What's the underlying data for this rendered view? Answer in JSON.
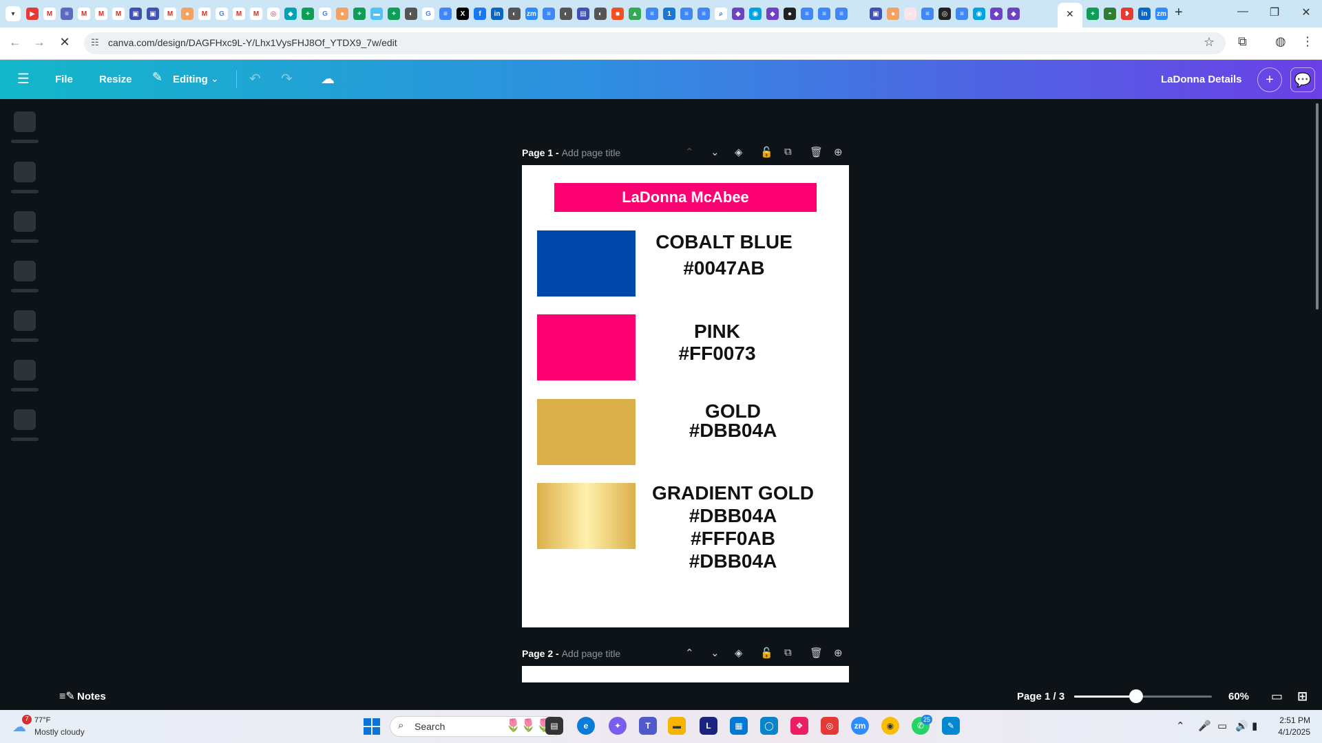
{
  "browser": {
    "url": "canva.com/design/DAGFHxc9L-Y/Lhx1VysFHJ8Of_YTDX9_7w/edit",
    "new_tab": "+",
    "win_min": "—",
    "win_max": "❐",
    "win_close": "✕",
    "tab_close": "✕"
  },
  "canva": {
    "file_label": "File",
    "resize_label": "Resize",
    "editing_label": "Editing",
    "doc_title": "LaDonna Details",
    "colors": {
      "brand_gradient_start": "#12b7c9",
      "brand_gradient_end": "#6b3fe6"
    }
  },
  "pages": [
    {
      "prefix": "Page 1 -",
      "title_placeholder": "Add page title"
    },
    {
      "prefix": "Page 2 -",
      "title_placeholder": "Add page title"
    }
  ],
  "design": {
    "name": "LaDonna McAbee",
    "colors": [
      {
        "lines": [
          "COBALT BLUE",
          "#0047AB"
        ],
        "swatch": "#0047ab"
      },
      {
        "lines": [
          "PINK",
          "#FF0073"
        ],
        "swatch": "#ff0073"
      },
      {
        "lines": [
          "GOLD",
          "#DBB04A"
        ],
        "swatch": "#dbb04a"
      },
      {
        "lines": [
          "GRADIENT GOLD",
          "#DBB04A",
          "#FFF0AB",
          "#DBB04A"
        ],
        "swatch": "gradient:#DBB04A,#FFF0AB,#DBB04A"
      }
    ]
  },
  "footer": {
    "notes_label": "Notes",
    "page_indicator": "Page 1 / 3",
    "zoom": "60%",
    "zoom_fraction": 0.45
  },
  "taskbar": {
    "weather_temp": "77°F",
    "weather_desc": "Mostly cloudy",
    "weather_badge": "7",
    "search_label": "Search",
    "time": "2:51 PM",
    "date": "4/1/2025",
    "whatsapp_badge": "25"
  }
}
